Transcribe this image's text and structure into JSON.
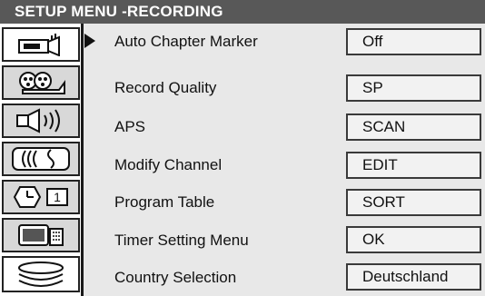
{
  "title": "SETUP MENU -RECORDING",
  "sidebar": {
    "icons": [
      {
        "name": "camcorder-icon"
      },
      {
        "name": "film-reel-icon"
      },
      {
        "name": "speaker-icon"
      },
      {
        "name": "signal-wave-icon"
      },
      {
        "name": "clock-icon",
        "text": "1"
      },
      {
        "name": "tv-icon"
      },
      {
        "name": "disc-stack-icon"
      }
    ]
  },
  "rows": [
    {
      "label": "Auto Chapter Marker",
      "value": "Off"
    },
    {
      "label": "Record Quality",
      "value": "SP"
    },
    {
      "label": "APS",
      "value": "SCAN"
    },
    {
      "label": "Modify Channel",
      "value": "EDIT"
    },
    {
      "label": "Program Table",
      "value": "SORT"
    },
    {
      "label": "Timer Setting Menu",
      "value": "OK"
    },
    {
      "label": "Country Selection",
      "value": "Deutschland"
    }
  ]
}
